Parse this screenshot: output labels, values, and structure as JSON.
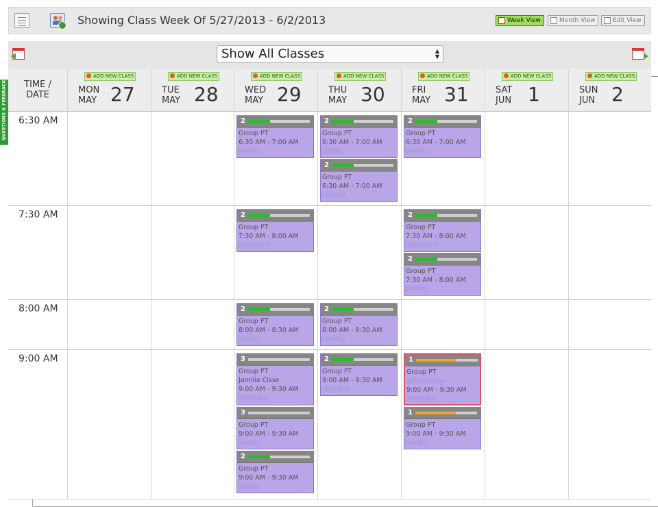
{
  "title": "Showing Class Week Of 5/27/2013 - 6/2/2013",
  "view_buttons": {
    "week": "Week View",
    "month": "Month View",
    "edit": "Edit View"
  },
  "filter": {
    "selected": "Show All Classes"
  },
  "feedback_tab": "QUESTIONS & FEEDBACK",
  "time_header": [
    "TIME /",
    "DATE"
  ],
  "add_label": "ADD NEW CLASS",
  "days": [
    {
      "dow": "MON",
      "mon": "MAY",
      "num": "27"
    },
    {
      "dow": "TUE",
      "mon": "MAY",
      "num": "28"
    },
    {
      "dow": "WED",
      "mon": "MAY",
      "num": "29"
    },
    {
      "dow": "THU",
      "mon": "MAY",
      "num": "30"
    },
    {
      "dow": "FRI",
      "mon": "MAY",
      "num": "31"
    },
    {
      "dow": "SAT",
      "mon": "JUN",
      "num": "1"
    },
    {
      "dow": "SUN",
      "mon": "JUN",
      "num": "2"
    }
  ],
  "time_rows": [
    "6:30 AM",
    "7:30 AM",
    "8:00 AM",
    "9:00 AM"
  ],
  "colors": {
    "card": "#b8a6e8",
    "bar_green": "#2cba2c",
    "bar_orange": "#f2a32b",
    "selected_border": "#e0506a"
  },
  "classes": [
    {
      "day": 2,
      "row": 0,
      "count": "2",
      "level": "green",
      "fill": 0.35,
      "name": "Group PT",
      "time": "6:30 AM - 7:00 AM",
      "instructor": "JUSTIN J"
    },
    {
      "day": 3,
      "row": 0,
      "count": "2",
      "level": "green",
      "fill": 0.35,
      "name": "Group PT",
      "time": "6:30 AM - 7:00 AM",
      "instructor": "JUSTIN J"
    },
    {
      "day": 3,
      "row": 0,
      "count": "2",
      "level": "green",
      "fill": 0.35,
      "name": "Group PT",
      "time": "6:30 AM - 7:00 AM",
      "instructor": "JULIAN A"
    },
    {
      "day": 4,
      "row": 0,
      "count": "2",
      "level": "green",
      "fill": 0.35,
      "name": "Group PT",
      "time": "6:30 AM - 7:00 AM",
      "instructor": "JUSTIN J"
    },
    {
      "day": 2,
      "row": 1,
      "count": "2",
      "level": "green",
      "fill": 0.35,
      "name": "Group PT",
      "time": "7:30 AM - 8:00 AM",
      "instructor": "GREGORY F"
    },
    {
      "day": 4,
      "row": 1,
      "count": "2",
      "level": "green",
      "fill": 0.35,
      "name": "Group PT",
      "time": "7:30 AM - 8:00 AM",
      "instructor": "GREGORY F"
    },
    {
      "day": 4,
      "row": 1,
      "count": "2",
      "level": "green",
      "fill": 0.35,
      "name": "Group PT",
      "time": "7:30 AM - 8:00 AM",
      "instructor": "JUSTIN J"
    },
    {
      "day": 2,
      "row": 2,
      "count": "2",
      "level": "green",
      "fill": 0.35,
      "name": "Group PT",
      "time": "8:00 AM - 8:30 AM",
      "instructor": "JUSTIN J"
    },
    {
      "day": 3,
      "row": 2,
      "count": "2",
      "level": "green",
      "fill": 0.35,
      "name": "Group PT",
      "time": "8:00 AM - 8:30 AM",
      "instructor": "JUSTIN J"
    },
    {
      "day": 2,
      "row": 3,
      "count": "3",
      "level": "none",
      "fill": 0,
      "name": "Group PT",
      "member": "Jamilia Cisse",
      "time": "9:00 AM - 9:30 AM",
      "instructor": "DESHON S"
    },
    {
      "day": 2,
      "row": 3,
      "count": "3",
      "level": "none",
      "fill": 0,
      "name": "Group PT",
      "time": "9:00 AM - 9:30 AM",
      "instructor": "JUSTIN J"
    },
    {
      "day": 2,
      "row": 3,
      "count": "2",
      "level": "green",
      "fill": 0.35,
      "name": "Group PT",
      "time": "9:00 AM - 9:30 AM",
      "instructor": "SETH A"
    },
    {
      "day": 3,
      "row": 3,
      "count": "2",
      "level": "green",
      "fill": 0.35,
      "name": "Group PT",
      "time": "9:00 AM - 9:30 AM",
      "instructor": "TAYLOR B"
    },
    {
      "day": 4,
      "row": 3,
      "count": "1",
      "level": "orange",
      "fill": 0.65,
      "name": "Group PT",
      "member": "william tucker",
      "time": "9:00 AM - 9:30 AM",
      "instructor": "DESHON S",
      "selected": true
    },
    {
      "day": 4,
      "row": 3,
      "count": "1",
      "level": "orange",
      "fill": 0.65,
      "name": "Group PT",
      "time": "9:00 AM - 9:30 AM",
      "instructor": "JUSTIN J"
    }
  ]
}
